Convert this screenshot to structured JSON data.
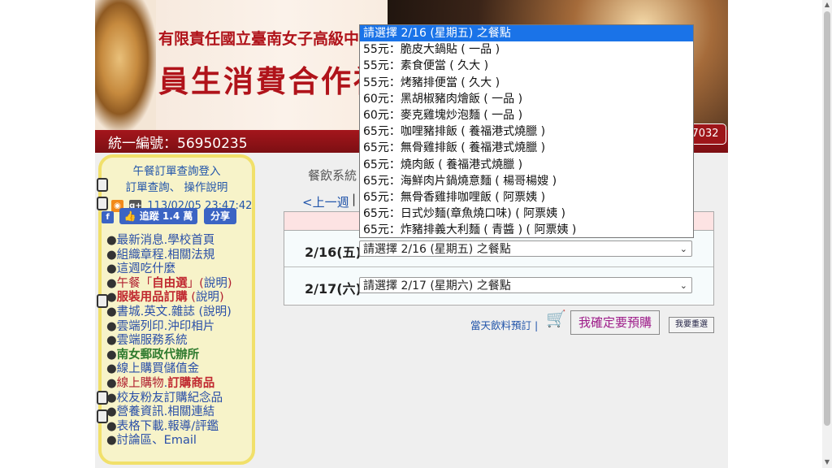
{
  "banner": {
    "school": "有限責任國立臺南女子高級中",
    "coop": "員生消費合作社",
    "tax_id": "統一編號：56950235",
    "phone_fragment": "7032"
  },
  "sidebar": {
    "login": "午餐訂單查詢登入",
    "help": "訂單查詢、 操作說明",
    "datetime": "113/02/05 23:47:42",
    "fb_follow": "追蹤 1.4 萬",
    "fb_share": "分享",
    "menu": [
      {
        "parts": [
          {
            "t": "最新消息",
            "c": ""
          },
          {
            "t": ".",
            "c": ""
          },
          {
            "t": "學校首頁",
            "c": ""
          }
        ]
      },
      {
        "parts": [
          {
            "t": "組織章程",
            "c": ""
          },
          {
            "t": ".",
            "c": ""
          },
          {
            "t": "相關法規",
            "c": ""
          }
        ]
      },
      {
        "parts": [
          {
            "t": "這週吃什麼",
            "c": ""
          }
        ]
      },
      {
        "parts": [
          {
            "t": "午餐「",
            "c": "mi-maroon"
          },
          {
            "t": "自由選",
            "c": "mi-red"
          },
          {
            "t": "」(",
            "c": "mi-maroon"
          },
          {
            "t": "說明",
            "c": ""
          },
          {
            "t": ")",
            "c": "mi-maroon"
          }
        ]
      },
      {
        "parts": [
          {
            "t": "服裝用品訂購",
            "c": "mi-red"
          },
          {
            "t": " (",
            "c": "mi-maroon"
          },
          {
            "t": "說明",
            "c": ""
          },
          {
            "t": ")",
            "c": "mi-maroon"
          }
        ]
      },
      {
        "parts": [
          {
            "t": "書城",
            "c": ""
          },
          {
            "t": ".",
            "c": ""
          },
          {
            "t": "英文",
            "c": ""
          },
          {
            "t": ".",
            "c": ""
          },
          {
            "t": "雜誌",
            "c": ""
          },
          {
            "t": " (",
            "c": ""
          },
          {
            "t": "說明",
            "c": ""
          },
          {
            "t": ")",
            "c": ""
          }
        ]
      },
      {
        "parts": [
          {
            "t": "雲端列印",
            "c": ""
          },
          {
            "t": ".",
            "c": ""
          },
          {
            "t": "沖印相片",
            "c": ""
          }
        ]
      },
      {
        "parts": [
          {
            "t": "雲端服務系統",
            "c": ""
          }
        ]
      },
      {
        "parts": [
          {
            "t": "南女郵政代辦所",
            "c": "mi-green"
          }
        ]
      },
      {
        "parts": [
          {
            "t": "線上購買儲值金",
            "c": ""
          }
        ]
      },
      {
        "parts": [
          {
            "t": "線上購物",
            "c": "mi-maroon"
          },
          {
            "t": ".",
            "c": ""
          },
          {
            "t": "訂購商品",
            "c": "mi-red"
          }
        ]
      },
      {
        "parts": [
          {
            "t": "校友粉友訂購紀念品",
            "c": ""
          }
        ]
      },
      {
        "parts": [
          {
            "t": "營養資訊",
            "c": ""
          },
          {
            "t": ".",
            "c": ""
          },
          {
            "t": "相關連結",
            "c": ""
          }
        ]
      },
      {
        "parts": [
          {
            "t": "表格下載",
            "c": ""
          },
          {
            "t": ".",
            "c": ""
          },
          {
            "t": "報導/評鑑",
            "c": ""
          }
        ]
      },
      {
        "parts": [
          {
            "t": "討論區",
            "c": ""
          },
          {
            "t": "、",
            "c": ""
          },
          {
            "t": "Email",
            "c": ""
          }
        ]
      }
    ]
  },
  "main": {
    "heading": "餐飲系統",
    "prev": "<上一週",
    "rows": [
      {
        "date": "2/16(五)",
        "select": "請選擇 2/16 (星期五) 之餐點"
      },
      {
        "date": "2/17(六)",
        "select": "請選擇 2/17 (星期六) 之餐點"
      }
    ],
    "drink_link": "當天飲料預訂",
    "separator": "|",
    "confirm": "我確定要預購",
    "reset": "我要重選"
  },
  "dropdown": {
    "options": [
      "請選擇 2/16 (星期五) 之餐點",
      "55元：脆皮大鍋貼 ( 一品 )",
      "55元：素食便當 ( 久大 )",
      "55元：烤豬排便當 ( 久大 )",
      "60元：黑胡椒豬肉燴飯 ( 一品 )",
      "60元：麥克雞塊炒泡麵 ( 一品 )",
      "65元：咖哩豬排飯 ( 養福港式燒臘 )",
      "65元：無骨雞排飯 ( 養福港式燒臘 )",
      "65元：燒肉飯 ( 養福港式燒臘 )",
      "65元：海鮮肉片鍋燒意麵 ( 楊哥楊嫂 )",
      "65元：無骨香雞排咖哩飯 ( 阿票姨 )",
      "65元：日式炒麵(章魚燒口味) ( 阿票姨 )",
      "65元：炸豬排義大利麵 ( 青醬 ) ( 阿票姨 )"
    ]
  },
  "colors": {
    "brand_red": "#b0131a",
    "link_blue": "#2255aa",
    "highlight": "#1a73e8"
  }
}
